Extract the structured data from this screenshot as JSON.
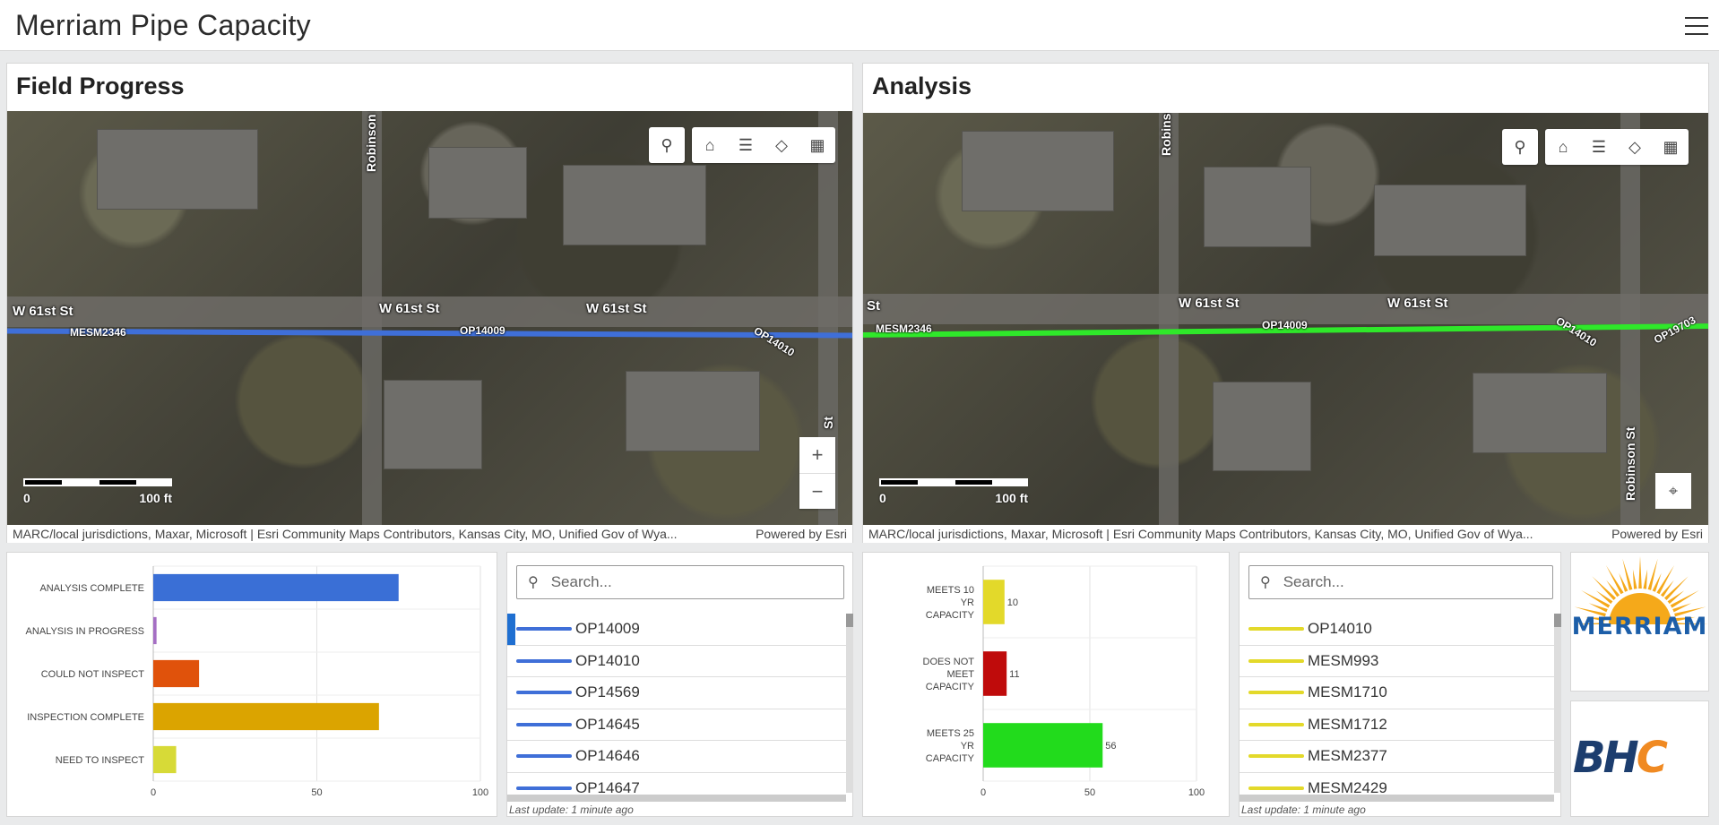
{
  "app": {
    "title": "Merriam Pipe Capacity"
  },
  "field_progress": {
    "title": "Field Progress",
    "streets": [
      "W 61st St",
      "W 61st St",
      "W 61st St",
      "Robinson St",
      "St"
    ],
    "pipes": [
      "MESM2346",
      "OP14009",
      "OP14010"
    ],
    "scale": {
      "zero": "0",
      "max": "100 ft"
    },
    "attribution": "MARC/local jurisdictions, Maxar, Microsoft | Esri Community Maps Contributors, Kansas City, MO, Unified Gov of Wya...",
    "powered_by": "Powered by Esri",
    "zoom_in": "+",
    "zoom_out": "−"
  },
  "analysis": {
    "title": "Analysis",
    "streets": [
      "St",
      "W 61st St",
      "W 61st St",
      "Robinson St",
      "Robinson St"
    ],
    "pipes": [
      "MESM2346",
      "OP14009",
      "OP14010",
      "OP19703"
    ],
    "scale": {
      "zero": "0",
      "max": "100 ft"
    },
    "attribution": "MARC/local jurisdictions, Maxar, Microsoft | Esri Community Maps Contributors, Kansas City, MO, Unified Gov of Wya...",
    "powered_by": "Powered by Esri"
  },
  "status_list": {
    "search_placeholder": "Search...",
    "items": [
      "OP14009",
      "OP14010",
      "OP14569",
      "OP14645",
      "OP14646",
      "OP14647"
    ],
    "color": "#3f6fd8",
    "last_update": "Last update: 1 minute ago"
  },
  "capacity_list": {
    "search_placeholder": "Search...",
    "items": [
      "OP14010",
      "MESM993",
      "MESM1710",
      "MESM1712",
      "MESM2377",
      "MESM2429"
    ],
    "color": "#e3d92a",
    "last_update": "Last update: 1 minute ago"
  },
  "logos": {
    "merriam": "MERRIAM",
    "bhc_b": "BH",
    "bhc_c": "C"
  },
  "chart_data": [
    {
      "type": "bar",
      "orientation": "horizontal",
      "categories": [
        "ANALYSIS COMPLETE",
        "ANALYSIS IN PROGRESS",
        "COULD NOT INSPECT",
        "INSPECTION COMPLETE",
        "NEED TO INSPECT"
      ],
      "values": [
        75,
        1,
        14,
        69,
        7
      ],
      "colors": [
        "#3a6fd6",
        "#a56fc4",
        "#e0520b",
        "#dba400",
        "#d7da37"
      ],
      "xlim": [
        0,
        100
      ],
      "xticks": [
        0,
        50,
        100
      ],
      "grid": true
    },
    {
      "type": "bar",
      "orientation": "horizontal",
      "categories": [
        "MEETS 10 YR CAPACITY",
        "DOES NOT MEET CAPACITY",
        "MEETS 25 YR CAPACITY"
      ],
      "values": [
        10,
        11,
        56
      ],
      "data_labels": [
        "10",
        "11",
        "56"
      ],
      "colors": [
        "#e3d92a",
        "#bf0b0b",
        "#22db1c"
      ],
      "xlim": [
        0,
        100
      ],
      "xticks": [
        0,
        50,
        100
      ],
      "grid": true
    }
  ]
}
